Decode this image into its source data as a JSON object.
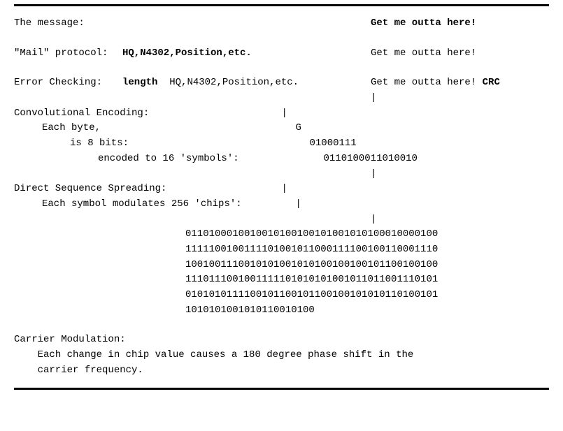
{
  "labels": {
    "message": "The message:",
    "mail_protocol": "\"Mail\" protocol:",
    "error_checking": "Error Checking:",
    "conv_enc": "Convolutional Encoding:",
    "each_byte": "Each byte,",
    "is_8_bits": "is 8 bits:",
    "encoded_16": "encoded to 16 'symbols':",
    "dss": "Direct Sequence Spreading:",
    "symbol_mod": "Each symbol modulates 256 'chips':",
    "carrier_mod": "Carrier Modulation:",
    "carrier_desc": "Each change in chip value causes a 180 degree phase shift in the\n    carrier frequency."
  },
  "fields": {
    "length": "length",
    "hq_etc_bold": "HQ,N4302,Position,etc.",
    "hq_etc": "HQ,N4302,Position,etc.",
    "crc": "CRC"
  },
  "message": {
    "bold": "Get me outta here!",
    "plain": "Get me outta here!"
  },
  "encoding": {
    "char": "G",
    "bits8": "01000111",
    "symbols16": "0110100011010010"
  },
  "pipe": "|",
  "chips": [
    "0110100010010010100100101001010100010000100",
    "1111100100111101001011000111100100110001110",
    "1001001110010101001010100100100101100100100",
    "1110111001001111101010101001011011001110101",
    "0101010111100101100101100100101010110100101",
    "1010101001010110010100"
  ]
}
